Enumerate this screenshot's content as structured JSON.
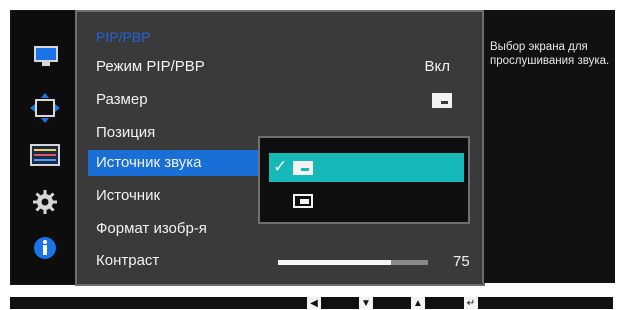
{
  "menu": {
    "title": "PIP/PBP",
    "items": [
      {
        "label": "Режим PIP/PBP",
        "value": "Вкл"
      },
      {
        "label": "Размер"
      },
      {
        "label": "Позиция"
      },
      {
        "label": "Источник звука"
      },
      {
        "label": "Источник"
      },
      {
        "label": "Формат изобр-я"
      },
      {
        "label": "Контраст"
      }
    ],
    "selected_index": 3
  },
  "submenu": {
    "options": [
      {
        "icon": "pip-window-icon",
        "checked": true
      },
      {
        "icon": "pip-window-outline-icon",
        "checked": false
      }
    ],
    "check_glyph": "✓"
  },
  "contrast": {
    "value": "75",
    "level_fraction": 0.75
  },
  "help": {
    "text": "Выбор экрана для прослушивания звука."
  },
  "rail_icons": [
    "monitor-icon",
    "size-position-icon",
    "adjust-sliders-icon",
    "settings-gear-icon",
    "info-icon"
  ],
  "bottom_nav": [
    "left-arrow-button",
    "down-arrow-button",
    "up-arrow-button",
    "enter-button"
  ],
  "colors": {
    "selection_blue": "#1a6fd6",
    "submenu_highlight": "#16b8b8",
    "title_blue": "#1f63e0",
    "panel_bg": "#3a3a3a"
  }
}
